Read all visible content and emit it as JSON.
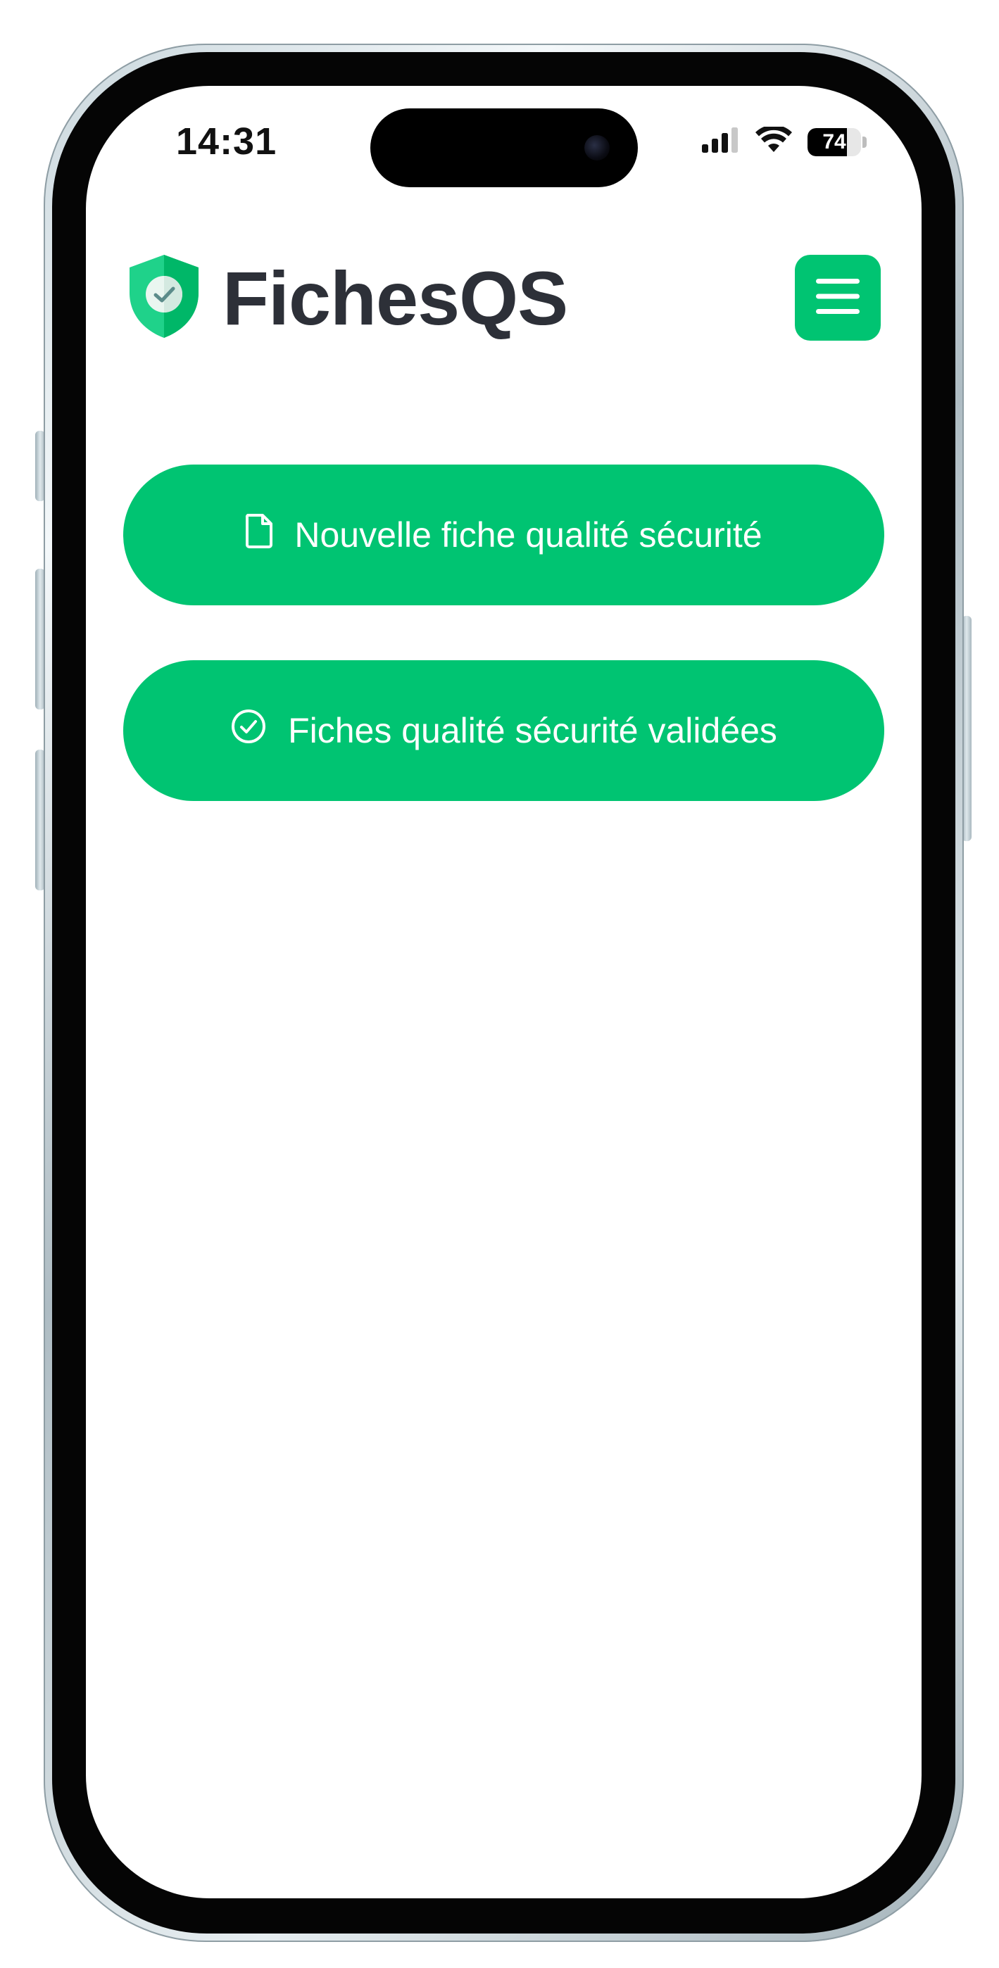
{
  "status_bar": {
    "time": "14:31",
    "battery_level": "74",
    "battery_percent": 74,
    "icons": [
      "cellular-signal-icon",
      "wifi-icon",
      "battery-icon"
    ]
  },
  "header": {
    "brand_name": "FichesQS",
    "logo_icon": "shield-check-icon",
    "menu_icon": "hamburger-menu-icon"
  },
  "actions": [
    {
      "label": "Nouvelle fiche qualité sécurité",
      "icon": "document-icon"
    },
    {
      "label": "Fiches qualité sécurité validées",
      "icon": "check-circle-icon"
    }
  ],
  "colors": {
    "accent": "#00c472",
    "title_text": "#2d3038",
    "button_text": "#ffffff"
  }
}
